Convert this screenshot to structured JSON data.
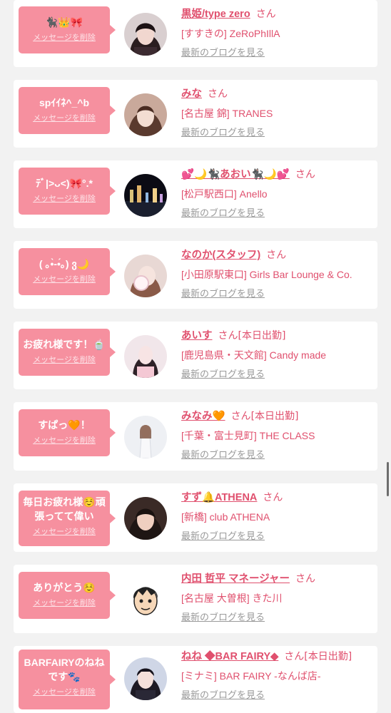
{
  "common": {
    "delete_label": "メッセージを削除",
    "blog_label": "最新のブログを見る",
    "san": "さん"
  },
  "colors": {
    "bubble": "#f6909f",
    "name": "#e0506e",
    "background": "#f2f2f2"
  },
  "entries": [
    {
      "message": "🐈‍⬛👑🎀",
      "name": "黒姫/type zero",
      "status": "",
      "shop": "[すすきの] ZeRoPhIllA"
    },
    {
      "message": "spｲｲﾈ^_^b",
      "name": "みな",
      "status": "",
      "shop": "[名古屋 錦] TRANES"
    },
    {
      "message": "ﾃﾞ|>ᴗ<)🎀°.*",
      "name": "💕🌙🐈‍⬛あおい🐈‍⬛🌙💕",
      "status": "",
      "shop": "[松戸駅西口] Anello"
    },
    {
      "message": "( ｡•̀-•́｡) ვ🌙",
      "name": "なのか(スタッフ)",
      "status": "",
      "shop": "[小田原駅東口] Girls Bar Lounge & Co."
    },
    {
      "message": "お疲れ様です！🍵",
      "name": "あいす",
      "status": "[本日出勤]",
      "shop": "[鹿児島県・天文館] Candy made"
    },
    {
      "message": "すぱっ🧡！",
      "name": "みなみ🧡",
      "status": "[本日出勤]",
      "shop": "[千葉・富士見町] THE CLASS"
    },
    {
      "message": "毎日お疲れ様☺️頑張ってて偉い",
      "name": "すず🔔ATHENA",
      "status": "",
      "shop": "[新橋] club ATHENA"
    },
    {
      "message": "ありがとう☺️",
      "name": "内田 哲平 マネージャー",
      "status": "",
      "shop": "[名古屋 大曽根] きた川"
    },
    {
      "message": "BARFAIRYのねねです🐾",
      "name": "ねね ◆BAR FAIRY◆",
      "status": "[本日出勤]",
      "shop": "[ミナミ] BAR FAIRY -なんば店-"
    }
  ]
}
